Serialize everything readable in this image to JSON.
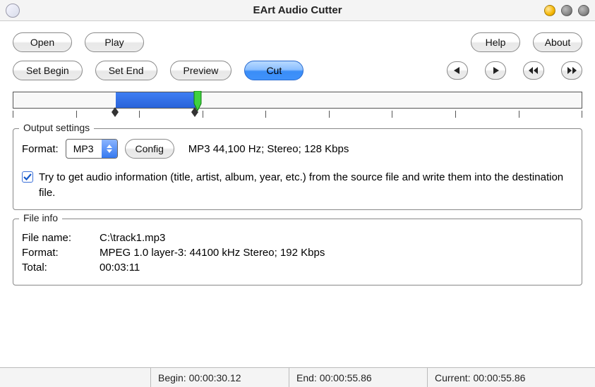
{
  "title": "EArt Audio Cutter",
  "toolbar": {
    "open": "Open",
    "play": "Play",
    "help": "Help",
    "about": "About",
    "set_begin": "Set Begin",
    "set_end": "Set End",
    "preview": "Preview",
    "cut": "Cut"
  },
  "output": {
    "legend": "Output settings",
    "format_label": "Format:",
    "format_value": "MP3",
    "config": "Config",
    "format_desc": "MP3 44,100 Hz; Stereo;  128 Kbps",
    "chk_checked": true,
    "chk_text": "Try to get audio information (title, artist, album, year, etc.) from the source file and write them into the destination file."
  },
  "fileinfo": {
    "legend": "File info",
    "name_k": "File name:",
    "name_v": "C:\\track1.mp3",
    "format_k": "Format:",
    "format_v": "MPEG 1.0 layer-3: 44100 kHz Stereo;  192 Kbps",
    "total_k": "Total:",
    "total_v": "00:03:11"
  },
  "status": {
    "begin": "Begin: 00:00:30.12",
    "end": "End: 00:00:55.86",
    "current": "Current: 00:00:55.86"
  }
}
